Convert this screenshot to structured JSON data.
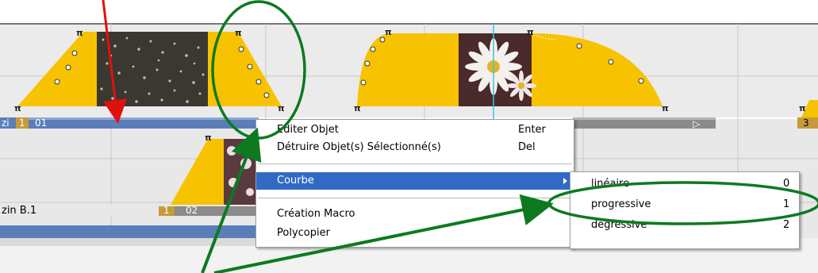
{
  "colors": {
    "track_bg": "#ebebeb",
    "track_bg_dark": "#cdcdcd",
    "curve_fill": "#f7c300",
    "clip_bar": "#5b7eb9",
    "clip_bar_gray": "#8b8b8b",
    "menu_highlight": "#316ac5",
    "annotation_green": "#0d7a20",
    "annotation_red": "#e01010"
  },
  "timeline": {
    "clips": [
      {
        "start_label": "1",
        "number_label": "01",
        "track_label": "zi"
      },
      {
        "start_label": "1",
        "number_label": "02",
        "track_label": "zin B.1"
      }
    ],
    "right_edge_label": "3"
  },
  "context_menu": {
    "items": [
      {
        "label": "Editer Objet",
        "shortcut": "Enter"
      },
      {
        "label": "Détruire Objet(s) Sélectionné(s)",
        "shortcut": "Del"
      },
      {
        "label": "Courbe",
        "shortcut": "",
        "submenu": true
      },
      {
        "label": "Création Macro",
        "shortcut": ""
      },
      {
        "label": "Polycopier",
        "shortcut": ""
      }
    ]
  },
  "submenu": {
    "items": [
      {
        "label": "linéaire",
        "shortcut": "0"
      },
      {
        "label": "progressive",
        "shortcut": "1"
      },
      {
        "label": "dégressive",
        "shortcut": "2"
      }
    ]
  }
}
